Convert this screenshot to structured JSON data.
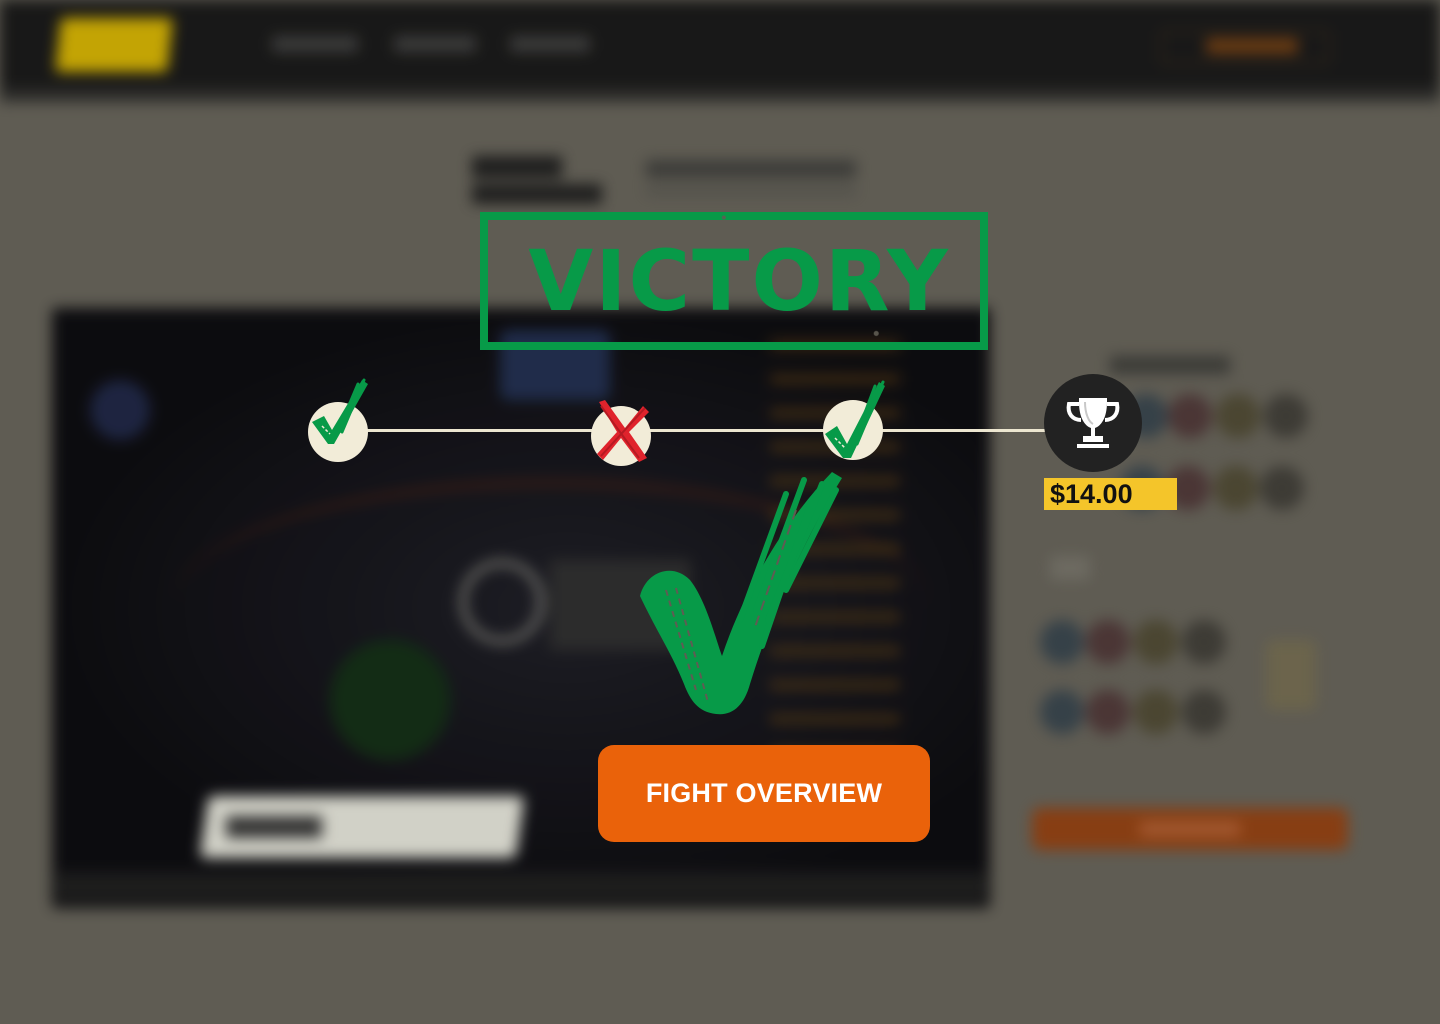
{
  "result": {
    "title": "VICTORY",
    "status_color": "#079a48",
    "loss_color": "#e0232c"
  },
  "progress": {
    "steps": [
      {
        "status": "win",
        "icon": "check-icon"
      },
      {
        "status": "loss",
        "icon": "cross-icon"
      },
      {
        "status": "win",
        "icon": "check-icon"
      },
      {
        "status": "reward",
        "icon": "trophy-icon"
      }
    ],
    "prize": "$14.00"
  },
  "actions": {
    "fight_overview_label": "FIGHT OVERVIEW",
    "accent_color": "#ea620a"
  },
  "theme": {
    "prize_badge_color": "#f4c52a",
    "node_color": "#f2ecd8",
    "trophy_node_color": "#222222"
  }
}
